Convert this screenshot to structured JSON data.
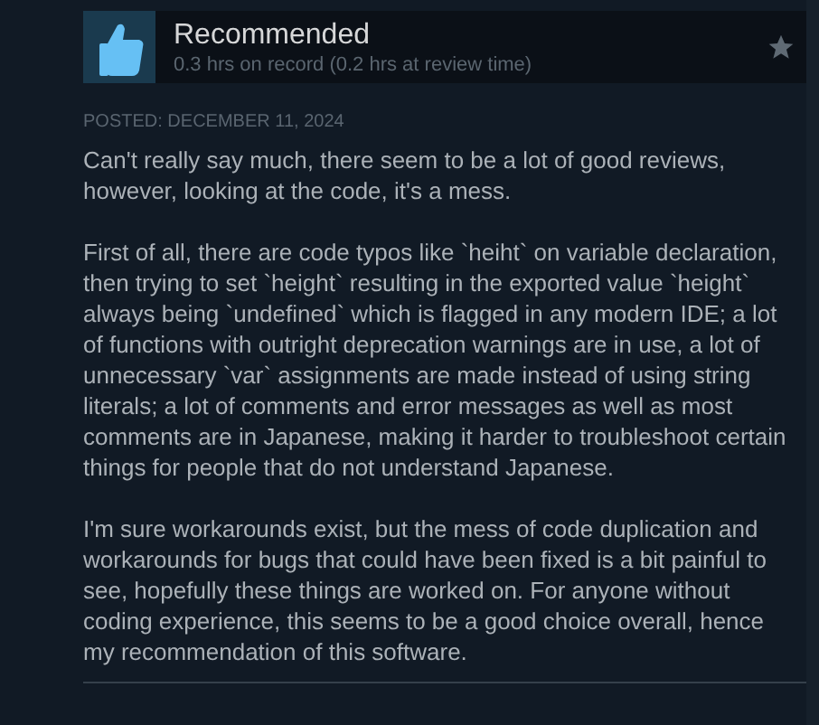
{
  "review": {
    "verdict": "Recommended",
    "hours": "0.3 hrs on record (0.2 hrs at review time)",
    "posted": "POSTED: DECEMBER 11, 2024",
    "paragraphs": [
      "Can't really say much, there seem to be a lot of good reviews, however, looking at the code, it's a mess.",
      "First of all, there are code typos like `heiht` on variable declaration, then trying to set `height` resulting in the exported value `height` always being `undefined` which is flagged in any modern IDE; a lot of functions with outright deprecation warnings are in use, a lot of unnecessary `var` assignments are made instead of using string literals; a lot of comments and error messages as well as most comments are in Japanese, making it harder to troubleshoot certain things for people that do not understand Japanese.",
      "I'm sure workarounds exist, but the mess of code duplication and workarounds for bugs that could have been fixed is a bit painful to see, hopefully these things are worked on. For anyone without coding experience, this seems to be a good choice overall, hence my recommendation of this software."
    ]
  }
}
